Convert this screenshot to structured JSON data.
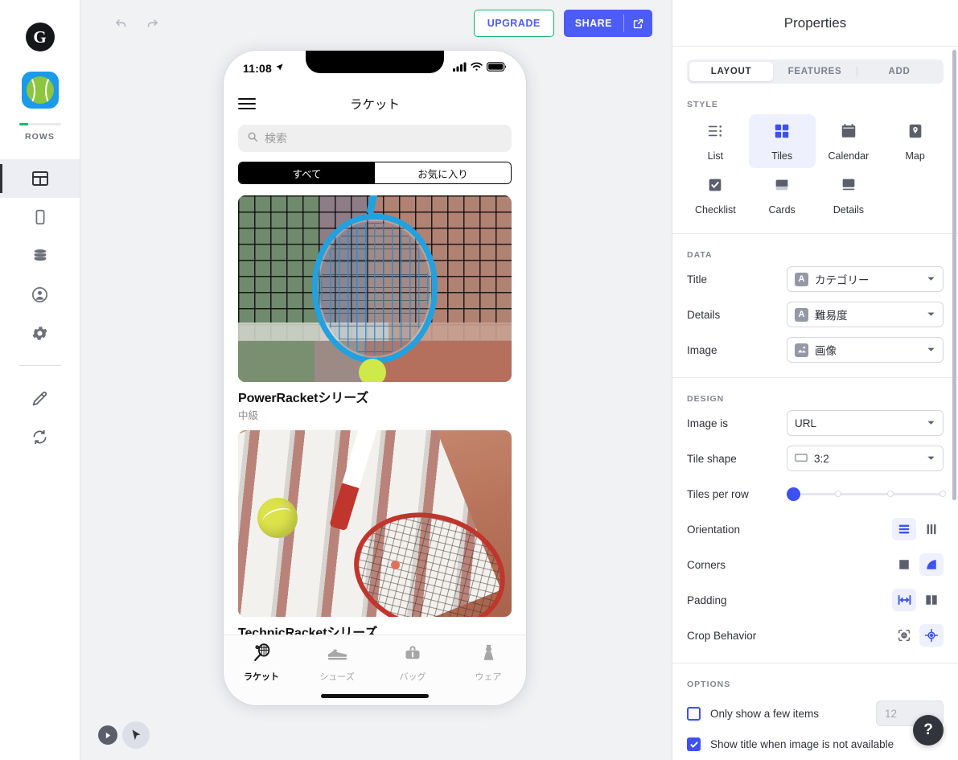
{
  "left_rail": {
    "logo_letter": "G",
    "app_name": "ROWS",
    "items": [
      {
        "name": "layout",
        "active": true
      },
      {
        "name": "device",
        "active": false
      },
      {
        "name": "data",
        "active": false
      },
      {
        "name": "users",
        "active": false
      },
      {
        "name": "settings",
        "active": false
      },
      {
        "name": "edit",
        "active": false
      },
      {
        "name": "sync",
        "active": false
      }
    ]
  },
  "toolbar": {
    "upgrade_label": "UPGRADE",
    "share_label": "SHARE",
    "upgrade_border_color": "#16b364",
    "share_bg_color": "#4c5cf5"
  },
  "phone": {
    "status_bar": {
      "time": "11:08"
    },
    "appbar": {
      "title": "ラケット"
    },
    "search": {
      "placeholder": "検索"
    },
    "segments": [
      {
        "label": "すべて",
        "active": true
      },
      {
        "label": "お気に入り",
        "active": false
      }
    ],
    "tiles": [
      {
        "title": "PowerRacketシリーズ",
        "subtitle": "中級"
      },
      {
        "title": "TechnicRacketシリーズ",
        "subtitle": ""
      }
    ],
    "tabbar": [
      {
        "label": "ラケット",
        "icon": "racket-icon",
        "active": true
      },
      {
        "label": "シューズ",
        "icon": "shoe-icon",
        "active": false
      },
      {
        "label": "バッグ",
        "icon": "bag-icon",
        "active": false
      },
      {
        "label": "ウェア",
        "icon": "dress-icon",
        "active": false
      }
    ]
  },
  "properties": {
    "header_title": "Properties",
    "tabs": [
      {
        "label": "LAYOUT",
        "active": true
      },
      {
        "label": "FEATURES",
        "active": false
      },
      {
        "label": "ADD",
        "active": false
      }
    ],
    "style": {
      "label": "STYLE",
      "options": [
        {
          "label": "List",
          "selected": false
        },
        {
          "label": "Tiles",
          "selected": true
        },
        {
          "label": "Calendar",
          "selected": false
        },
        {
          "label": "Map",
          "selected": false
        },
        {
          "label": "Checklist",
          "selected": false
        },
        {
          "label": "Cards",
          "selected": false
        },
        {
          "label": "Details",
          "selected": false
        }
      ]
    },
    "data": {
      "label": "DATA",
      "rows": [
        {
          "label": "Title",
          "value": "カテゴリー",
          "badge": "A"
        },
        {
          "label": "Details",
          "value": "難易度",
          "badge": "A"
        },
        {
          "label": "Image",
          "value": "画像",
          "badge": "image"
        }
      ]
    },
    "design": {
      "label": "DESIGN",
      "image_is": {
        "label": "Image is",
        "value": "URL"
      },
      "tile_shape": {
        "label": "Tile shape",
        "value": "3:2"
      },
      "tiles_per_row": {
        "label": "Tiles per row",
        "value": 1,
        "steps": 4
      },
      "orientation": {
        "label": "Orientation",
        "selected": 0
      },
      "corners": {
        "label": "Corners",
        "selected": 1
      },
      "padding": {
        "label": "Padding",
        "selected": 0
      },
      "crop_behavior": {
        "label": "Crop Behavior",
        "selected": 1
      }
    },
    "options": {
      "label": "OPTIONS",
      "only_few": {
        "label": "Only show a few items",
        "checked": false,
        "count": "12"
      },
      "show_title": {
        "label": "Show title when image is not available",
        "checked": true
      }
    },
    "accent_color": "#3d50f0"
  },
  "help": {
    "label": "?"
  }
}
